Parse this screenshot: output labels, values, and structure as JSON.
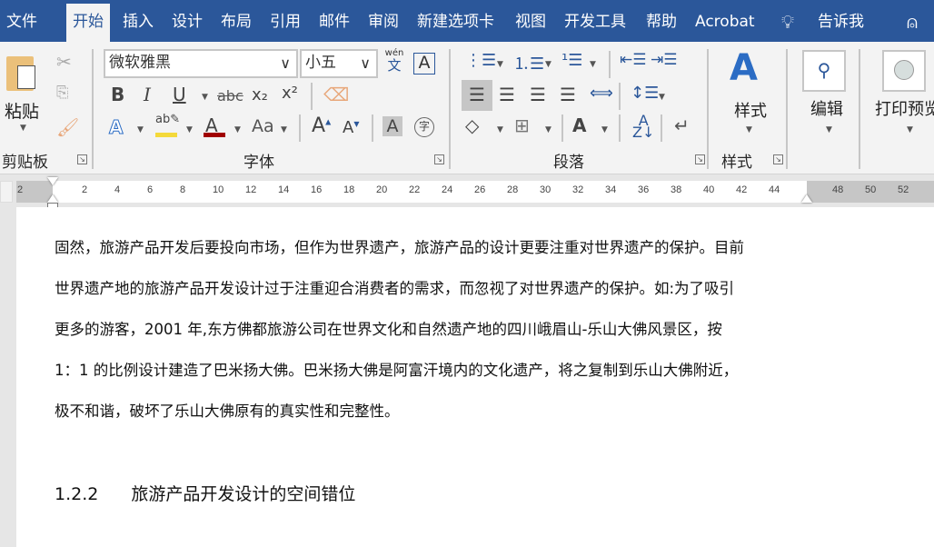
{
  "tabs": [
    "文件",
    "开始",
    "插入",
    "设计",
    "布局",
    "引用",
    "邮件",
    "审阅",
    "新建选项卡",
    "视图",
    "开发工具",
    "帮助",
    "Acrobat"
  ],
  "active_tab": "开始",
  "tell_me": "告诉我",
  "clipboard": {
    "paste": "粘贴",
    "group": "剪贴板"
  },
  "font": {
    "name": "微软雅黑",
    "size": "小五",
    "group": "字体",
    "phonetic_top": "wén",
    "phonetic_bottom": "文",
    "bold": "B",
    "italic": "I",
    "underline": "U",
    "strike": "abc",
    "sub": "x₂",
    "sup": "x²",
    "case": "Aa",
    "enclose": "字"
  },
  "paragraph": {
    "group": "段落"
  },
  "styles": {
    "label": "样式",
    "group": "样式"
  },
  "editing": {
    "label": "编辑"
  },
  "print_preview": {
    "label": "打印预览"
  },
  "colors": {
    "accent": "#2b579a",
    "highlight": "#f4d93a",
    "font_color": "#a00000"
  },
  "ruler": {
    "left_labels": [
      "2"
    ],
    "labels": [
      "2",
      "4",
      "6",
      "8",
      "10",
      "12",
      "14",
      "16",
      "18",
      "20",
      "22",
      "24",
      "26",
      "28",
      "30",
      "32",
      "34",
      "36",
      "38",
      "40",
      "42",
      "44"
    ],
    "right_labels": [
      "48",
      "50",
      "52"
    ]
  },
  "document": {
    "lines": [
      "固然，旅游产品开发后要投向市场，但作为世界遗产，旅游产品的设计更要注重对世界遗产的保护。目前",
      "世界遗产地的旅游产品开发设计过于注重迎合消费者的需求，而忽视了对世界遗产的保护。如:为了吸引",
      "更多的游客，2001 年,东方佛都旅游公司在世界文化和自然遗产地的四川峨眉山-乐山大佛风景区，按",
      "1：1 的比例设计建造了巴米扬大佛。巴米扬大佛是阿富汗境内的文化遗产，将之复制到乐山大佛附近，",
      "极不和谐，破坏了乐山大佛原有的真实性和完整性。"
    ],
    "heading_number": "1.2.2",
    "heading_text": "旅游产品开发设计的空间错位"
  }
}
